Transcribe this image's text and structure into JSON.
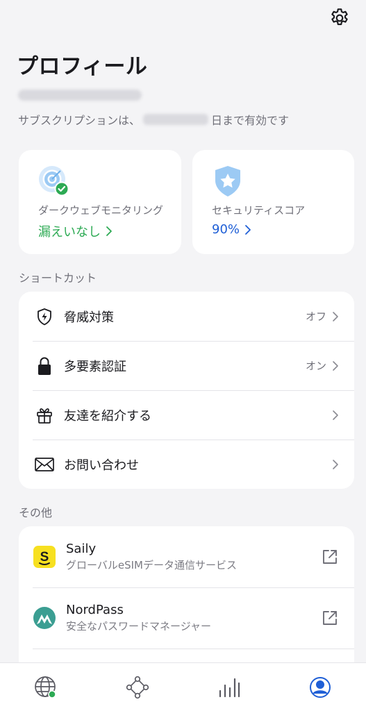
{
  "header": {
    "title": "プロフィール",
    "settings_icon": "gear-icon"
  },
  "subscription": {
    "prefix": "サブスクリプションは、",
    "suffix": "日まで有効です"
  },
  "cards": [
    {
      "label": "ダークウェブモニタリング",
      "value": "漏えいなし",
      "icon": "target-check-icon",
      "color": "#2daa54"
    },
    {
      "label": "セキュリティスコア",
      "value": "90%",
      "icon": "shield-star-icon",
      "color": "#1f5fd6"
    }
  ],
  "shortcuts": {
    "label": "ショートカット",
    "items": [
      {
        "label": "脅威対策",
        "status": "オフ",
        "icon": "shield-bolt-icon"
      },
      {
        "label": "多要素認証",
        "status": "オン",
        "icon": "lock-icon"
      },
      {
        "label": "友達を紹介する",
        "status": "",
        "icon": "gift-icon"
      },
      {
        "label": "お問い合わせ",
        "status": "",
        "icon": "mail-icon"
      }
    ]
  },
  "other": {
    "label": "その他",
    "apps": [
      {
        "name": "Saily",
        "desc": "グローバルeSIMデータ通信サービス",
        "icon": "saily-logo"
      },
      {
        "name": "NordPass",
        "desc": "安全なパスワードマネージャー",
        "icon": "nordpass-logo"
      }
    ]
  },
  "tabbar": [
    "globe-icon",
    "meshnet-icon",
    "stats-icon",
    "profile-icon"
  ]
}
